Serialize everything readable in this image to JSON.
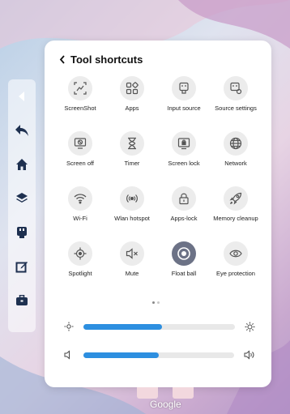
{
  "panel": {
    "title": "Tool shortcuts",
    "tools": [
      {
        "label": "ScreenShot",
        "icon": "screenshot-icon",
        "active": false
      },
      {
        "label": "Apps",
        "icon": "apps-icon",
        "active": false
      },
      {
        "label": "Input source",
        "icon": "input-source-icon",
        "active": false
      },
      {
        "label": "Source settings",
        "icon": "source-settings-icon",
        "active": false
      },
      {
        "label": "Screen off",
        "icon": "screen-off-icon",
        "active": false
      },
      {
        "label": "Timer",
        "icon": "hourglass-icon",
        "active": false
      },
      {
        "label": "Screen lock",
        "icon": "screen-lock-icon",
        "active": false
      },
      {
        "label": "Network",
        "icon": "globe-icon",
        "active": false
      },
      {
        "label": "Wi-Fi",
        "icon": "wifi-icon",
        "active": false
      },
      {
        "label": "Wlan hotspot",
        "icon": "hotspot-icon",
        "active": false
      },
      {
        "label": "Apps-lock",
        "icon": "lock-icon",
        "active": false
      },
      {
        "label": "Memory cleanup",
        "icon": "rocket-icon",
        "active": false
      },
      {
        "label": "Spotlight",
        "icon": "spotlight-icon",
        "active": false
      },
      {
        "label": "Mute",
        "icon": "mute-icon",
        "active": false
      },
      {
        "label": "Float ball",
        "icon": "float-ball-icon",
        "active": true
      },
      {
        "label": "Eye protection",
        "icon": "eye-icon",
        "active": false
      }
    ],
    "brightness_level": 0.52,
    "volume_level": 0.5,
    "page_count": 2,
    "current_page": 0
  },
  "sidebar": [
    "collapse-icon",
    "back-icon",
    "home-icon",
    "layers-icon",
    "usb-icon",
    "annotate-icon",
    "toolbox-icon"
  ],
  "dock": {
    "label": "Google"
  },
  "colors": {
    "accent": "#2d8fe0",
    "active_tool": "#6c7286"
  }
}
